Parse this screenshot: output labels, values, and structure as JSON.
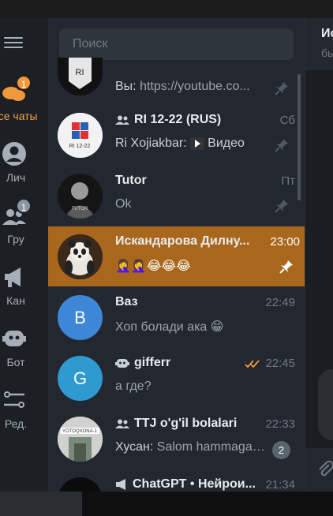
{
  "search": {
    "placeholder": "Поиск"
  },
  "folders": [
    {
      "label": "Все чаты",
      "badge": "1",
      "icon": "chat-bubbles-icon",
      "active": true
    },
    {
      "label": "Лич",
      "badge": "",
      "icon": "person-icon"
    },
    {
      "label": "Гру",
      "badge": "1",
      "icon": "group-icon"
    },
    {
      "label": "Кан",
      "badge": "",
      "icon": "megaphone-icon"
    },
    {
      "label": "Бот",
      "badge": "",
      "icon": "bot-icon"
    },
    {
      "label": "Ред.",
      "badge": "",
      "icon": "edit-folders-icon"
    }
  ],
  "chats": [
    {
      "name": "",
      "time": "",
      "sender": "Вы: ",
      "preview": "https://youtube.co...",
      "pinned": true
    },
    {
      "name": "RI 12-22 (RUS)",
      "time": "Сб",
      "sender": "Ri Xojiakbar: ",
      "preview": "Видео",
      "pinned": true,
      "group": true
    },
    {
      "name": "Tutor",
      "time": "Пт",
      "sender": "",
      "preview": "Ok",
      "pinned": true
    },
    {
      "name": "Искандарова Дилну...",
      "time": "23:00",
      "sender": "",
      "preview": "🤦‍♀️🤦‍♀️😂😂😂",
      "pinned": true,
      "active": true
    },
    {
      "name": "Ваз",
      "time": "22:49",
      "sender": "",
      "preview": "Хоп болади ака 😁",
      "avatar_letter": "В",
      "avatar_color": "#3d87d6"
    },
    {
      "name": "gifferr",
      "time": "22:45",
      "sender": "",
      "preview": "а где?",
      "avatar_letter": "G",
      "avatar_color": "#2f9ad0",
      "bot": true,
      "read": true
    },
    {
      "name": "TTJ o'g'il bolalari",
      "time": "22:33",
      "sender": "Хусан: ",
      "preview": "Salom hammaga ...",
      "unread": "2",
      "group": true
    },
    {
      "name": "ChatGPT • Нейрои...",
      "time": "21:34",
      "sender": "",
      "preview": "",
      "channel": true
    }
  ],
  "chat_header": {
    "title": "Ис",
    "status": "бы"
  }
}
